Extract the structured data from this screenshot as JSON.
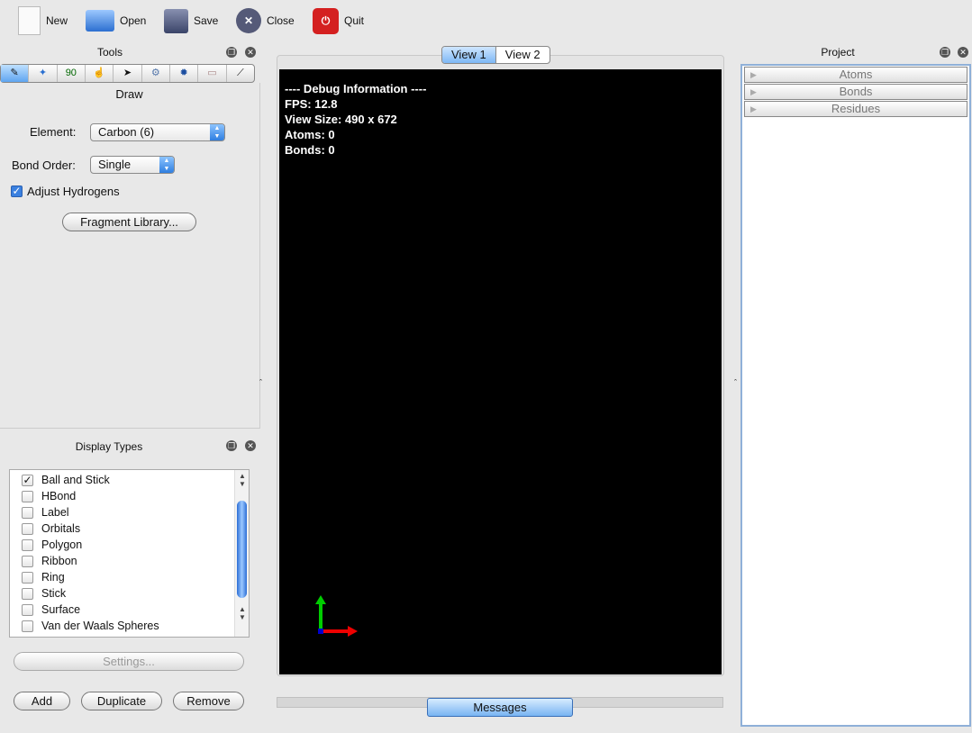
{
  "toolbar": {
    "new": "New",
    "open": "Open",
    "save": "Save",
    "close": "Close",
    "quit": "Quit"
  },
  "tools": {
    "title": "Tools",
    "icons": [
      "pencil",
      "navigate",
      "measure-angle",
      "manipulate",
      "select",
      "auto-optimize",
      "optimize-gear",
      "ruler",
      "align"
    ],
    "angle_label": "90",
    "mode": "Draw",
    "element_label": "Element:",
    "element_value": "Carbon (6)",
    "bond_label": "Bond Order:",
    "bond_value": "Single",
    "adjust_h": "Adjust Hydrogens",
    "adjust_h_checked": true,
    "fragment": "Fragment Library..."
  },
  "display": {
    "title": "Display Types",
    "items": [
      {
        "label": "Ball and Stick",
        "checked": true
      },
      {
        "label": "HBond",
        "checked": false
      },
      {
        "label": "Label",
        "checked": false
      },
      {
        "label": "Orbitals",
        "checked": false
      },
      {
        "label": "Polygon",
        "checked": false
      },
      {
        "label": "Ribbon",
        "checked": false
      },
      {
        "label": "Ring",
        "checked": false
      },
      {
        "label": "Stick",
        "checked": false
      },
      {
        "label": "Surface",
        "checked": false
      },
      {
        "label": "Van der Waals Spheres",
        "checked": false
      }
    ],
    "settings": "Settings...",
    "add": "Add",
    "duplicate": "Duplicate",
    "remove": "Remove"
  },
  "views": {
    "tabs": [
      "View 1",
      "View 2"
    ],
    "debug": [
      "---- Debug Information ----",
      "FPS: 12.8",
      "View Size: 490 x 672",
      "Atoms: 0",
      "Bonds: 0"
    ],
    "messages": "Messages"
  },
  "project": {
    "title": "Project",
    "rows": [
      "Atoms",
      "Bonds",
      "Residues"
    ]
  }
}
